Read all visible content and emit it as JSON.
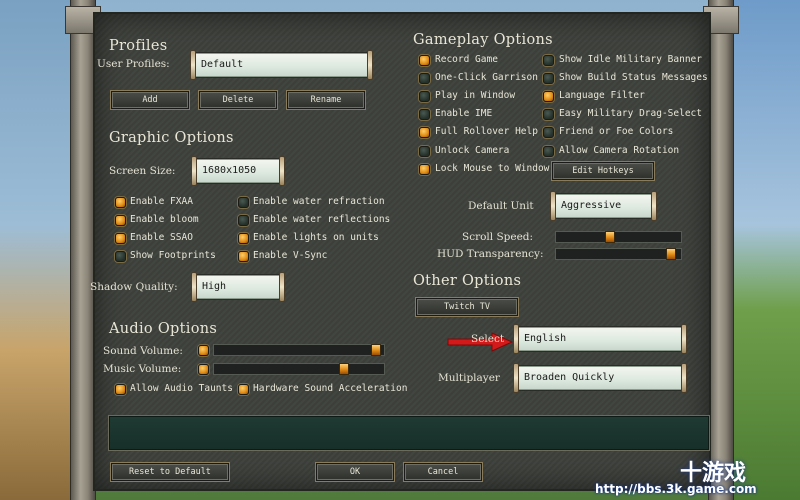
{
  "profiles": {
    "title": "Profiles",
    "user_profiles_label": "User Profiles:",
    "user_profiles_value": "Default",
    "add_label": "Add",
    "delete_label": "Delete",
    "rename_label": "Rename"
  },
  "graphic": {
    "title": "Graphic Options",
    "screen_size_label": "Screen Size:",
    "screen_size_value": "1680x1050",
    "options": [
      {
        "label": "Enable FXAA",
        "checked": true
      },
      {
        "label": "Enable water refraction",
        "checked": false
      },
      {
        "label": "Enable bloom",
        "checked": true
      },
      {
        "label": "Enable water reflections",
        "checked": false
      },
      {
        "label": "Enable SSAO",
        "checked": true
      },
      {
        "label": "Enable lights on units",
        "checked": true
      },
      {
        "label": "Show Footprints",
        "checked": false
      },
      {
        "label": "Enable V-Sync",
        "checked": true
      }
    ],
    "shadow_quality_label": "Shadow Quality:",
    "shadow_quality_value": "High"
  },
  "audio": {
    "title": "Audio Options",
    "sound_volume_label": "Sound Volume:",
    "sound_volume_level": 0.98,
    "music_volume_label": "Music Volume:",
    "music_volume_level": 0.78,
    "allow_taunts_label": "Allow Audio Taunts",
    "hardware_sound_label": "Hardware Sound Acceleration"
  },
  "gameplay": {
    "title": "Gameplay Options",
    "left_options": [
      {
        "label": "Record Game",
        "checked": true
      },
      {
        "label": "One-Click Garrison",
        "checked": false
      },
      {
        "label": "Play in Window",
        "checked": false
      },
      {
        "label": "Enable IME",
        "checked": false
      },
      {
        "label": "Full Rollover Help",
        "checked": true
      },
      {
        "label": "Unlock Camera",
        "checked": false
      },
      {
        "label": "Lock Mouse to Window",
        "checked": true
      }
    ],
    "right_options": [
      {
        "label": "Show Idle Military Banner",
        "checked": false
      },
      {
        "label": "Show Build Status Messages",
        "checked": false
      },
      {
        "label": "Language Filter",
        "checked": true
      },
      {
        "label": "Easy Military Drag-Select",
        "checked": false
      },
      {
        "label": "Friend or Foe Colors",
        "checked": false
      },
      {
        "label": "Allow Camera Rotation",
        "checked": false
      }
    ],
    "edit_hotkeys_label": "Edit Hotkeys",
    "default_unit_label": "Default Unit",
    "default_unit_value": "Aggressive",
    "scroll_speed_label": "Scroll Speed:",
    "scroll_speed_level": 0.43,
    "hud_transparency_label": "HUD Transparency:",
    "hud_transparency_level": 0.96
  },
  "other": {
    "title": "Other Options",
    "twitch_label": "Twitch TV",
    "select_label": "Select",
    "select_value": "English",
    "multiplayer_label": "Multiplayer",
    "multiplayer_value": "Broaden Quickly"
  },
  "footer": {
    "reset_label": "Reset to Default",
    "ok_label": "OK",
    "cancel_label": "Cancel"
  },
  "watermark": {
    "text": "http://bbs.3k.game.com",
    "logo_text": "十游戏"
  },
  "colors": {
    "checkbox_on": "#e08a14",
    "checkbox_off": "#25302a",
    "panel": "#3c3f3a",
    "arrow": "#d21a1a"
  }
}
